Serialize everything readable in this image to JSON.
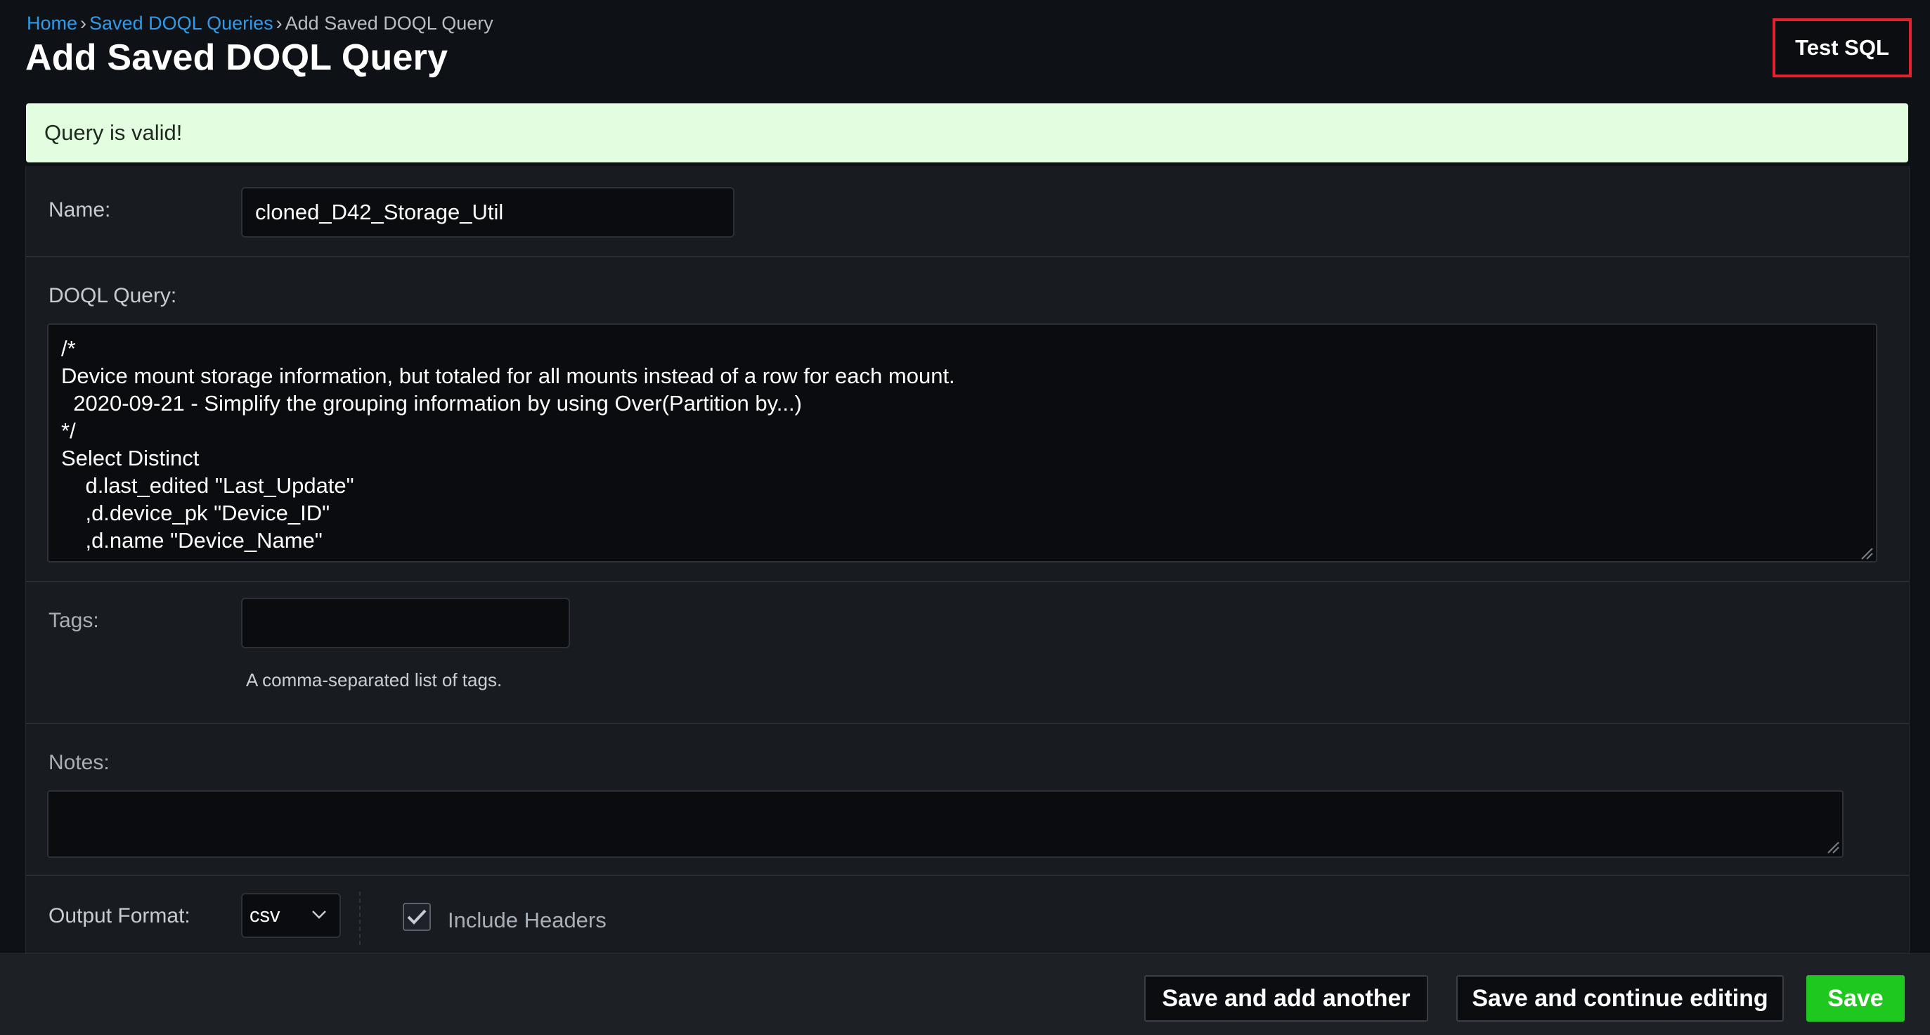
{
  "breadcrumb": {
    "home": "Home",
    "saved_queries": "Saved DOQL Queries",
    "current": "Add Saved DOQL Query",
    "separator": "›"
  },
  "header": {
    "title": "Add Saved DOQL Query",
    "test_sql_label": "Test SQL"
  },
  "alert": {
    "message": "Query is valid!",
    "background": "#e3fde0"
  },
  "form": {
    "name": {
      "label": "Name:",
      "value": "cloned_D42_Storage_Util"
    },
    "doql_query": {
      "label": "DOQL Query:",
      "value": "/*\nDevice mount storage information, but totaled for all mounts instead of a row for each mount.\n  2020-09-21 - Simplify the grouping information by using Over(Partition by...)\n*/\nSelect Distinct\n    d.last_edited \"Last_Update\"\n    ,d.device_pk \"Device_ID\"\n    ,d.name \"Device_Name\""
    },
    "tags": {
      "label": "Tags:",
      "value": "",
      "help": "A comma-separated list of tags."
    },
    "notes": {
      "label": "Notes:",
      "value": ""
    },
    "output_format": {
      "label": "Output Format:",
      "selected": "csv",
      "include_headers_label": "Include Headers",
      "include_headers_checked": true
    }
  },
  "footer": {
    "save_add_another": "Save and add another",
    "save_continue": "Save and continue editing",
    "save": "Save"
  },
  "colors": {
    "link": "#2e9bea",
    "highlight_border": "#e0232f",
    "save_green": "#1ec81e",
    "page_bg": "#0e1116",
    "panel_bg": "#181b20"
  }
}
